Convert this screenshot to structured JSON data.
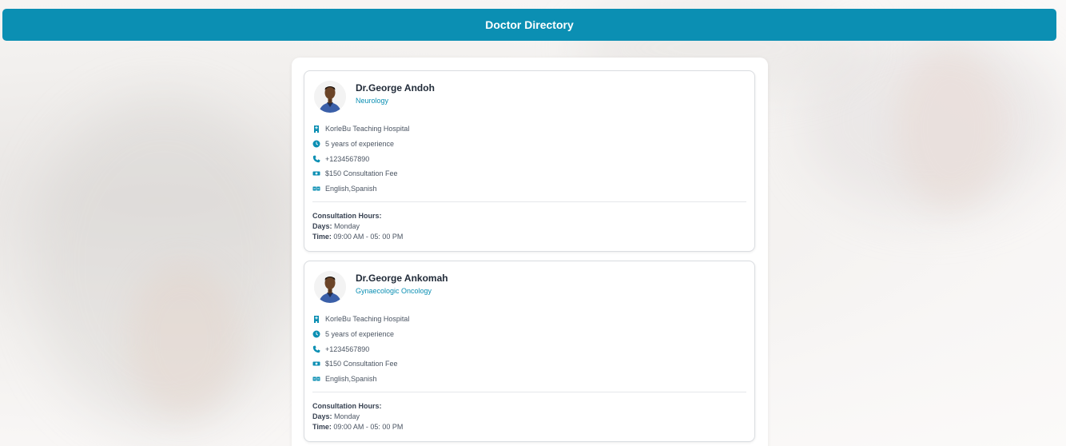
{
  "header": {
    "title": "Doctor Directory"
  },
  "colors": {
    "accent": "#0b8fb3",
    "card_border": "#dadde1"
  },
  "doctors": [
    {
      "name": "Dr.George Andoh",
      "specialty": "Neurology",
      "hospital": "KorleBu Teaching Hospital",
      "experience": "5 years of experience",
      "phone": "+1234567890",
      "fee": "$150 Consultation Fee",
      "languages": "English,Spanish",
      "hours_title": "Consultation Hours:",
      "days_label": "Days:",
      "days": "Monday",
      "time_label": "Time:",
      "time": "09:00 AM - 05: 00 PM"
    },
    {
      "name": "Dr.George Ankomah",
      "specialty": "Gynaecologic Oncology",
      "hospital": "KorleBu Teaching Hospital",
      "experience": "5 years of experience",
      "phone": "+1234567890",
      "fee": "$150 Consultation Fee",
      "languages": "English,Spanish",
      "hours_title": "Consultation Hours:",
      "days_label": "Days:",
      "days": "Monday",
      "time_label": "Time:",
      "time": "09:00 AM - 05: 00 PM"
    }
  ],
  "icons": [
    "hospital-icon",
    "clock-icon",
    "phone-icon",
    "money-icon",
    "language-icon",
    "avatar-photo"
  ]
}
